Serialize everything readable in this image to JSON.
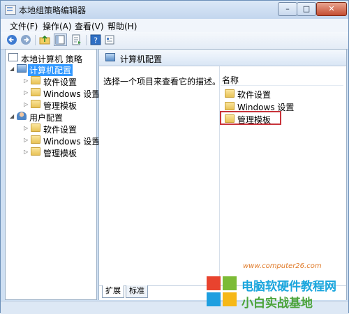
{
  "window": {
    "title": "本地组策略编辑器",
    "controls": {
      "minimize": "–",
      "maximize": "□",
      "close": "✕"
    }
  },
  "menu": [
    "文件(F)",
    "操作(A)",
    "查看(V)",
    "帮助(H)"
  ],
  "toolbar": {
    "icons": [
      "back-arrow-icon",
      "forward-arrow-icon",
      "up-folder-icon",
      "show-hide-tree-icon",
      "export-list-icon",
      "help-icon",
      "properties-icon"
    ]
  },
  "tree": {
    "root": "本地计算机 策略",
    "computer": {
      "label": "计算机配置",
      "children": [
        "软件设置",
        "Windows 设置",
        "管理模板"
      ]
    },
    "user": {
      "label": "用户配置",
      "children": [
        "软件设置",
        "Windows 设置",
        "管理模板"
      ]
    }
  },
  "detail": {
    "header": "计算机配置",
    "description": "选择一个项目来查看它的描述。",
    "column_name": "名称",
    "items": [
      "软件设置",
      "Windows 设置",
      "管理模板"
    ],
    "highlighted_index": 2
  },
  "tabs": [
    "扩展",
    "标准"
  ],
  "watermark": {
    "title": "电脑软硬件教程网",
    "subtitle": "小白实战基地",
    "url": "www.computer26.com",
    "colors": [
      "#e8432e",
      "#7cbb36",
      "#1e9fe0",
      "#f6b817"
    ]
  }
}
